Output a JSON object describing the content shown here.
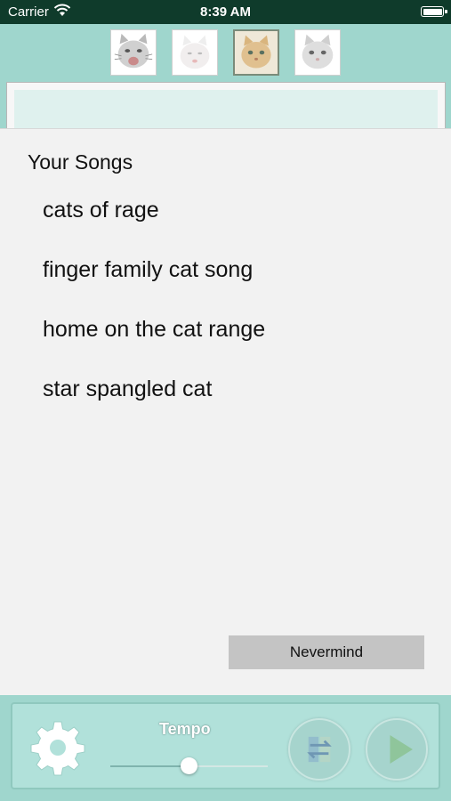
{
  "status_bar": {
    "carrier": "Carrier",
    "time": "8:39 AM"
  },
  "cats": [
    {
      "icon": "angry-kitten-icon",
      "selected": false
    },
    {
      "icon": "white-kitten-icon",
      "selected": false
    },
    {
      "icon": "orange-kitten-icon",
      "selected": true
    },
    {
      "icon": "gray-kitten-icon",
      "selected": false
    }
  ],
  "panel": {
    "title": "Your Songs",
    "songs": [
      "cats of rage",
      "finger family cat song",
      "home on the cat range",
      "star spangled cat"
    ],
    "dismiss_label": "Nevermind"
  },
  "controls": {
    "tempo_label": "Tempo",
    "tempo_fraction": 0.5,
    "settings_icon": "gear-icon",
    "shuffle_icon": "shuffle-icon",
    "play_icon": "play-icon"
  },
  "colors": {
    "teal": "#9fd6cd",
    "panel": "#f2f2f2",
    "status_bar": "#0f3b2b",
    "button_gray": "#c4c4c4"
  }
}
